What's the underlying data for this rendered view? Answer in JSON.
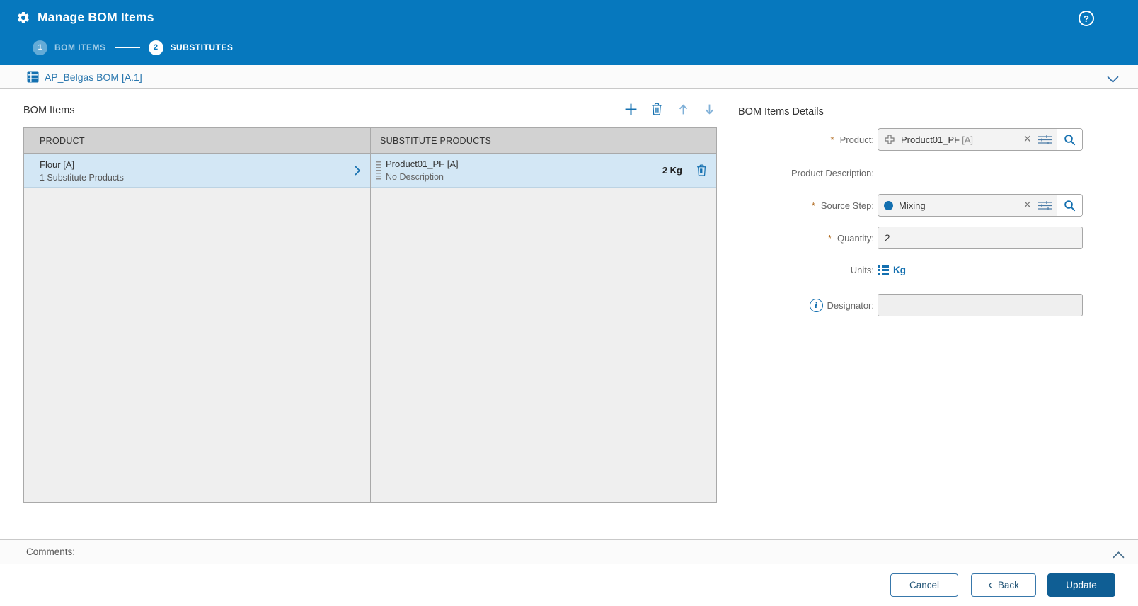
{
  "window": {
    "title": "Manage BOM Items",
    "help_glyph": "?"
  },
  "steps": [
    {
      "number": "1",
      "label": "BOM ITEMS",
      "state": "visited"
    },
    {
      "number": "2",
      "label": "SUBSTITUTES",
      "state": "active"
    }
  ],
  "bom_selector": {
    "label": "AP_Belgas BOM [A.1]"
  },
  "bom_items": {
    "title": "BOM Items",
    "columns": {
      "product": "PRODUCT",
      "substitutes": "SUBSTITUTE PRODUCTS"
    },
    "rows": [
      {
        "product_name": "Flour [A]",
        "product_info": "1 Substitute Products",
        "substitute_name": "Product01_PF [A]",
        "substitute_info": "No Description",
        "quantity": "2 Kg"
      }
    ]
  },
  "details": {
    "title": "BOM Items Details",
    "product": {
      "label": "Product:",
      "value": "Product01_PF",
      "revision": "[A]",
      "required": true
    },
    "product_description": {
      "label": "Product Description:",
      "value": ""
    },
    "source_step": {
      "label": "Source Step:",
      "value": "Mixing",
      "required": true
    },
    "quantity": {
      "label": "Quantity:",
      "value": "2",
      "required": true
    },
    "units": {
      "label": "Units:",
      "value": "Kg"
    },
    "designator": {
      "label": "Designator:",
      "value": ""
    }
  },
  "comments": {
    "label": "Comments:"
  },
  "footer": {
    "cancel_label": "Cancel",
    "back_chevron": "‹",
    "back_label": "Back",
    "update_label": "Update"
  },
  "icons": {
    "header_left": "gear-icon",
    "header_right": "help-icon",
    "bom_bar": "table-icon",
    "toolbar": [
      "add-icon",
      "trash-icon",
      "arrow-up-icon",
      "arrow-down-icon"
    ],
    "clear_glyph": "×",
    "product_field": "bom-structure-icon",
    "source_step_field": "workflow-step-dot-icon",
    "units_field": "list-icon",
    "designator_label": "info-icon",
    "search": "magnifier-icon",
    "filter": "sliders-icon"
  },
  "colors": {
    "header_blue": "#0678be",
    "accent_blue": "#1470b0",
    "link_blue": "#2a77ae",
    "selected_row": "#d3e7f5",
    "table_header_gray": "#d2d2d2",
    "table_body_gray": "#efefef",
    "update_button": "#0f5e94",
    "required_asterisk": "#b06a1e"
  }
}
